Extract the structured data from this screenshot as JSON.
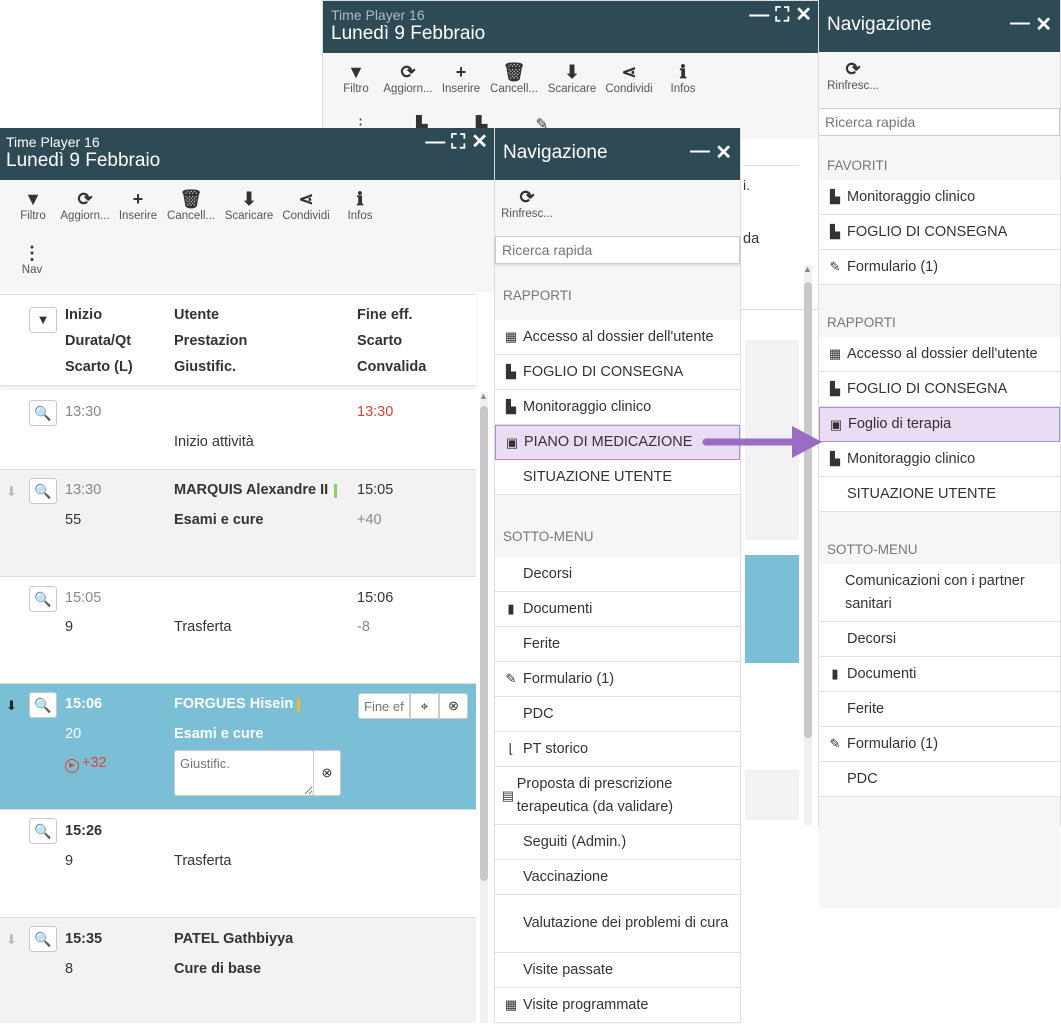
{
  "back_window": {
    "app": "Time Player 16",
    "date": "Lunedì 9 Febbraio",
    "toolbar": [
      {
        "label": "Filtro",
        "icon": "filter-icon",
        "glyph": "▼"
      },
      {
        "label": "Aggiorn...",
        "icon": "refresh-icon",
        "glyph": "⟳"
      },
      {
        "label": "Inserire",
        "icon": "plus-icon",
        "glyph": "+"
      },
      {
        "label": "Cancell...",
        "icon": "trash-icon",
        "glyph": "🗑"
      },
      {
        "label": "Scaricare",
        "icon": "download-icon",
        "glyph": "⬇"
      },
      {
        "label": "Condividi",
        "icon": "share-icon",
        "glyph": "⋖"
      },
      {
        "label": "Infos",
        "icon": "info-icon",
        "glyph": "ℹ"
      }
    ],
    "peek_texts": [
      "i.",
      "da"
    ]
  },
  "main_window": {
    "app": "Time Player 16",
    "date": "Lunedì 9 Febbraio",
    "toolbar": [
      {
        "label": "Filtro",
        "icon": "filter-icon",
        "glyph": "▼"
      },
      {
        "label": "Aggiorn...",
        "icon": "refresh-icon",
        "glyph": "⟳"
      },
      {
        "label": "Inserire",
        "icon": "plus-icon",
        "glyph": "+"
      },
      {
        "label": "Cancell...",
        "icon": "trash-icon",
        "glyph": "🗑"
      },
      {
        "label": "Scaricare",
        "icon": "download-icon",
        "glyph": "⬇"
      },
      {
        "label": "Condividi",
        "icon": "share-icon",
        "glyph": "⋖"
      },
      {
        "label": "Infos",
        "icon": "info-icon",
        "glyph": "ℹ"
      }
    ],
    "nav_label": "Nav",
    "headers": {
      "c1": [
        "Inizio",
        "Durata/Qt",
        "Scarto (L)"
      ],
      "c2": [
        "Utente",
        "Prestazion",
        "Giustific."
      ],
      "c3": [
        "Fine eff.",
        "Scarto",
        "Convalida"
      ]
    },
    "rows": [
      {
        "start": "13:30",
        "duration": "",
        "user": "",
        "service": "Inizio attività",
        "end": "13:30",
        "delta": ""
      },
      {
        "start": "13:30",
        "duration": "55",
        "user": "MARQUIS Alexandre II",
        "service": "Esami e cure",
        "end": "15:05",
        "delta": "+40"
      },
      {
        "start": "15:05",
        "duration": "9",
        "user": "",
        "service": "Trasferta",
        "end": "15:06",
        "delta": "-8"
      },
      {
        "start": "15:06",
        "duration": "20",
        "user": "FORGUES Hisein",
        "service": "Esami e cure",
        "end": "",
        "delta": "+32",
        "fine_placeholder": "Fine eff.",
        "giust_placeholder": "Giustific."
      },
      {
        "start": "15:26",
        "duration": "9",
        "user": "",
        "service": "Trasferta",
        "end": "",
        "delta": ""
      },
      {
        "start": "15:35",
        "duration": "8",
        "user": "PATEL Gathbiyya",
        "service": "Cure di base",
        "end": "",
        "delta": ""
      }
    ]
  },
  "nav_left": {
    "title": "Navigazione",
    "refresh_label": "Rinfresc...",
    "search_placeholder": "Ricerca rapida",
    "section_reports": "RAPPORTI",
    "reports": [
      {
        "label": "Accesso al dossier dell'utente",
        "icon": "grid-icon",
        "glyph": "▦"
      },
      {
        "label": "FOGLIO DI CONSEGNA",
        "icon": "document-icon",
        "glyph": "▙"
      },
      {
        "label": "Monitoraggio clinico",
        "icon": "document-icon",
        "glyph": "▙"
      },
      {
        "label": "PIANO DI MEDICAZIONE",
        "icon": "document-icon",
        "glyph": "▣"
      },
      {
        "label": "SITUAZIONE UTENTE",
        "icon": "",
        "glyph": ""
      }
    ],
    "section_submenu": "SOTTO-MENU",
    "submenu": [
      {
        "label": "Decorsi",
        "icon": "",
        "glyph": ""
      },
      {
        "label": "Documenti",
        "icon": "book-icon",
        "glyph": "▮"
      },
      {
        "label": "Ferite",
        "icon": "",
        "glyph": ""
      },
      {
        "label": "Formulario (1)",
        "icon": "edit-icon",
        "glyph": "✎"
      },
      {
        "label": "PDC",
        "icon": "",
        "glyph": ""
      },
      {
        "label": "PT storico",
        "icon": "chart-icon",
        "glyph": "⌊"
      },
      {
        "label": "Proposta di prescrizione terapeutica (da validare)",
        "icon": "calendar-plus-icon",
        "glyph": "▤"
      },
      {
        "label": "Seguiti (Admin.)",
        "icon": "",
        "glyph": ""
      },
      {
        "label": "Vaccinazione",
        "icon": "",
        "glyph": ""
      },
      {
        "label": "Valutazione dei problemi di cura",
        "icon": "",
        "glyph": ""
      },
      {
        "label": "Visite passate",
        "icon": "",
        "glyph": ""
      },
      {
        "label": "Visite programmate",
        "icon": "calendar-icon",
        "glyph": "▦"
      }
    ]
  },
  "nav_right": {
    "title": "Navigazione",
    "refresh_label": "Rinfresc...",
    "search_placeholder": "Ricerca rapida",
    "section_favorites": "FAVORITI",
    "favorites": [
      {
        "label": "Monitoraggio clinico",
        "icon": "document-icon",
        "glyph": "▙"
      },
      {
        "label": "FOGLIO DI CONSEGNA",
        "icon": "document-icon",
        "glyph": "▙"
      },
      {
        "label": "Formulario (1)",
        "icon": "edit-icon",
        "glyph": "✎"
      }
    ],
    "section_reports": "RAPPORTI",
    "reports": [
      {
        "label": "Accesso al dossier dell'utente",
        "icon": "grid-icon",
        "glyph": "▦"
      },
      {
        "label": "FOGLIO DI CONSEGNA",
        "icon": "document-icon",
        "glyph": "▙"
      },
      {
        "label": "Foglio di terapia",
        "icon": "document-icon",
        "glyph": "▣"
      },
      {
        "label": "Monitoraggio clinico",
        "icon": "document-icon",
        "glyph": "▙"
      },
      {
        "label": "SITUAZIONE UTENTE",
        "icon": "",
        "glyph": ""
      }
    ],
    "section_submenu": "SOTTO-MENU",
    "submenu": [
      {
        "label": "Comunicazioni con i partner sanitari",
        "icon": "",
        "glyph": ""
      },
      {
        "label": "Decorsi",
        "icon": "",
        "glyph": ""
      },
      {
        "label": "Documenti",
        "icon": "book-icon",
        "glyph": "▮"
      },
      {
        "label": "Ferite",
        "icon": "",
        "glyph": ""
      },
      {
        "label": "Formulario (1)",
        "icon": "edit-icon",
        "glyph": "✎"
      },
      {
        "label": "PDC",
        "icon": "",
        "glyph": ""
      }
    ]
  },
  "colors": {
    "titlebar": "#2e4b55",
    "selected_row": "#7bbfd6",
    "highlight": "#eadcf3",
    "arrow": "#9a6cc4",
    "late": "#d9443a"
  }
}
